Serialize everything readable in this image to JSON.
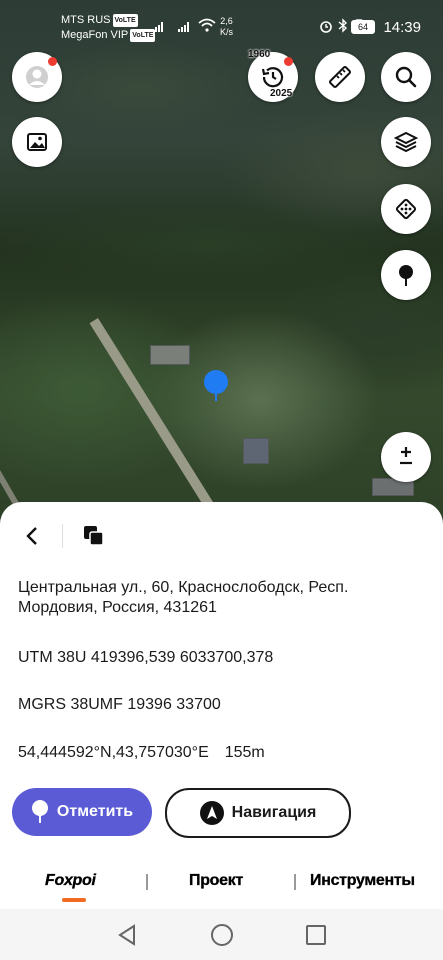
{
  "status_bar": {
    "operator1": "MTS RUS",
    "operator2": "MegaFon VIP",
    "volte": "VoLTE",
    "speed_value": "2,6",
    "speed_unit": "K/s",
    "battery": "64",
    "time": "14:39"
  },
  "map": {
    "history_year_start": "1960",
    "history_year_end": "2025"
  },
  "sheet": {
    "address": "Центральная ул., 60, Краснослободск, Респ. Мордовия, Россия, 431261",
    "utm": "UTM 38U 419396,539 6033700,378",
    "mgrs": "MGRS 38UMF 19396 33700",
    "latlon": "54,444592°N,43,757030°E",
    "altitude": "155m",
    "mark_button": "Отметить",
    "nav_button": "Навигация"
  },
  "tabs": {
    "foxpoi": "Foxpoi",
    "project": "Проект",
    "tools": "Инструменты"
  },
  "colors": {
    "accent": "#5b5bd6",
    "pin": "#1f7cf2",
    "tab_underline": "#f06a22",
    "notification_dot": "#ee3b2f"
  }
}
